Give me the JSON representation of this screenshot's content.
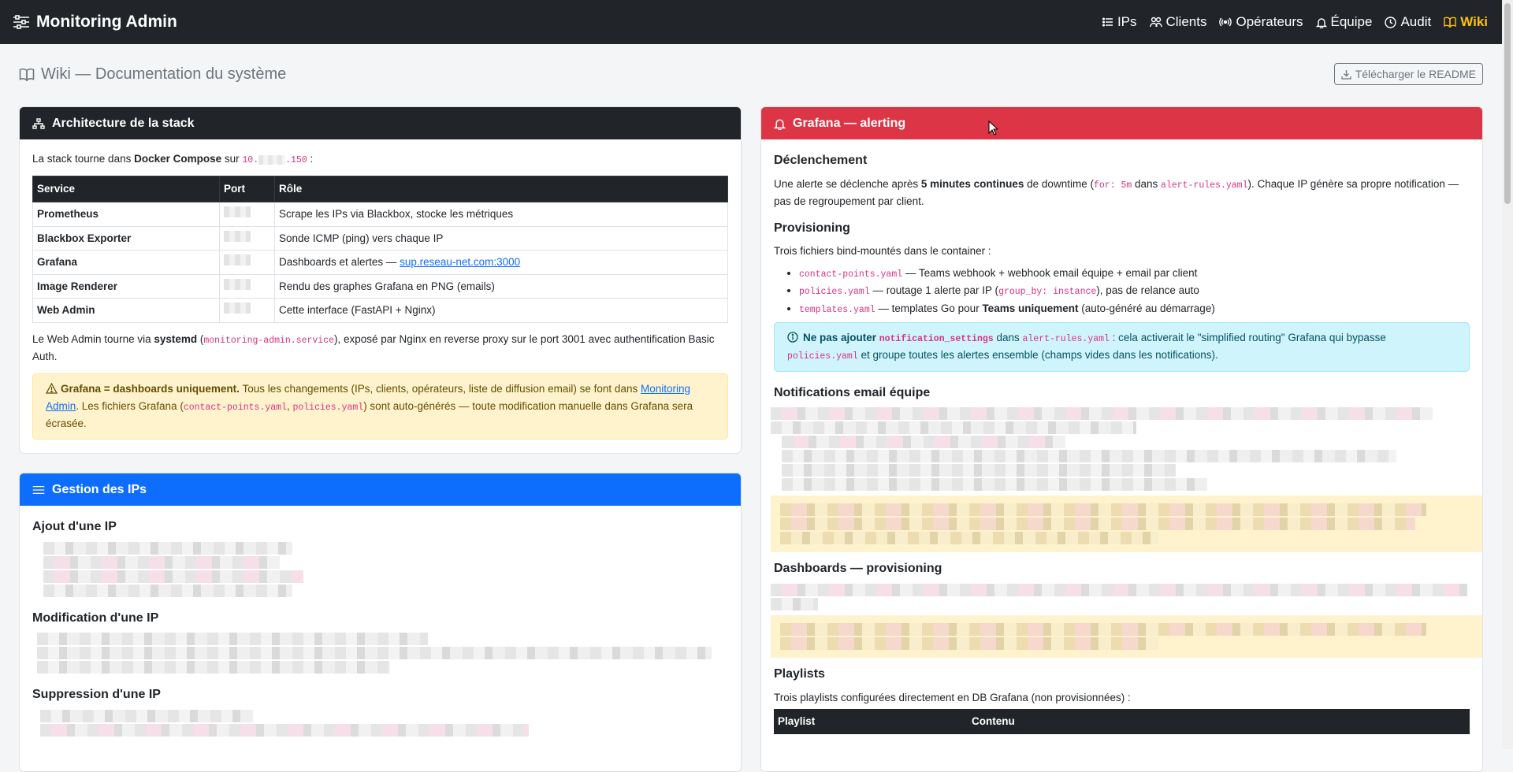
{
  "app": {
    "title": "Monitoring Admin"
  },
  "nav": {
    "items": [
      {
        "key": "ips",
        "label": "IPs",
        "icon": "list-icon"
      },
      {
        "key": "clients",
        "label": "Clients",
        "icon": "people-icon"
      },
      {
        "key": "operateurs",
        "label": "Opérateurs",
        "icon": "broadcast-icon"
      },
      {
        "key": "equipe",
        "label": "Équipe",
        "icon": "bell-icon"
      },
      {
        "key": "audit",
        "label": "Audit",
        "icon": "clock-icon"
      },
      {
        "key": "wiki",
        "label": "Wiki",
        "icon": "book-icon",
        "active": true
      }
    ]
  },
  "page": {
    "title": "Wiki — Documentation du système",
    "download_label": "Télécharger le README"
  },
  "arch": {
    "header": "Architecture de la stack",
    "intro_prefix": "La stack tourne dans ",
    "intro_strong": "Docker Compose",
    "intro_mid": " sur ",
    "ip_start": "10.",
    "ip_end": ".150",
    "intro_suffix": " :",
    "columns": [
      "Service",
      "Port",
      "Rôle"
    ],
    "rows": [
      {
        "service": "Prometheus",
        "role": "Scrape les IPs via Blackbox, stocke les métriques"
      },
      {
        "service": "Blackbox Exporter",
        "role": "Sonde ICMP (ping) vers chaque IP"
      },
      {
        "service": "Grafana",
        "role": "Dashboards et alertes — ",
        "link": "sup.reseau-net.com:3000"
      },
      {
        "service": "Image Renderer",
        "role": "Rendu des graphes Grafana en PNG (emails)"
      },
      {
        "service": "Web Admin",
        "role": "Cette interface (FastAPI + Nginx)"
      }
    ],
    "webadmin_prefix": "Le Web Admin tourne via ",
    "webadmin_strong": "systemd",
    "webadmin_open": " (",
    "webadmin_code": "monitoring-admin.service",
    "webadmin_suffix": "), exposé par Nginx en reverse proxy sur le port 3001 avec authentification Basic Auth.",
    "warn_strong": "Grafana = dashboards uniquement.",
    "warn_text": " Tous les changements (IPs, clients, opérateurs, liste de diffusion email) se font dans ",
    "warn_link": "Monitoring Admin",
    "warn_text2": ". Les fichiers Grafana (",
    "warn_code1": "contact-points.yaml",
    "warn_sep": ", ",
    "warn_code2": "policies.yaml",
    "warn_text3": ") sont auto-générés — toute modification manuelle dans Grafana sera écrasée."
  },
  "ips": {
    "header": "Gestion des IPs",
    "add_title": "Ajout d'une IP",
    "edit_title": "Modification d'une IP",
    "delete_title": "Suppression d'une IP"
  },
  "grafana": {
    "header": "Grafana — alerting",
    "trigger_title": "Déclenchement",
    "trigger_p1": "Une alerte se déclenche après ",
    "trigger_strong": "5 minutes continues",
    "trigger_p2": " de downtime (",
    "trigger_code1": "for: 5m",
    "trigger_p3": " dans ",
    "trigger_code2": "alert-rules.yaml",
    "trigger_p4": "). Chaque IP génère sa propre notification — pas de regroupement par client.",
    "prov_title": "Provisioning",
    "prov_intro": "Trois fichiers bind-mountés dans le container :",
    "files": [
      {
        "code": "contact-points.yaml",
        "text": " — Teams webhook + webhook email équipe + email par client"
      },
      {
        "code": "policies.yaml",
        "text": " — routage 1 alerte par IP (",
        "code2": "group_by: instance",
        "text2": "), pas de relance auto"
      },
      {
        "code": "templates.yaml",
        "text": " — templates Go pour ",
        "strong": "Teams uniquement",
        "text2": " (auto-généré au démarrage)"
      }
    ],
    "info_strong": "Ne pas ajouter ",
    "info_code1": "notification_settings",
    "info_t1": " dans ",
    "info_code2": "alert-rules.yaml",
    "info_t2": " : cela activerait le \"simplified routing\" Grafana qui bypasse ",
    "info_code3": "policies.yaml",
    "info_t3": " et groupe toutes les alertes ensemble (champs vides dans les notifications).",
    "email_title": "Notifications email équipe",
    "dash_title": "Dashboards — provisioning",
    "playlists_title": "Playlists",
    "playlists_intro": "Trois playlists configurées directement en DB Grafana (non provisionnées) :",
    "playlists_columns": [
      "Playlist",
      "Contenu"
    ]
  }
}
